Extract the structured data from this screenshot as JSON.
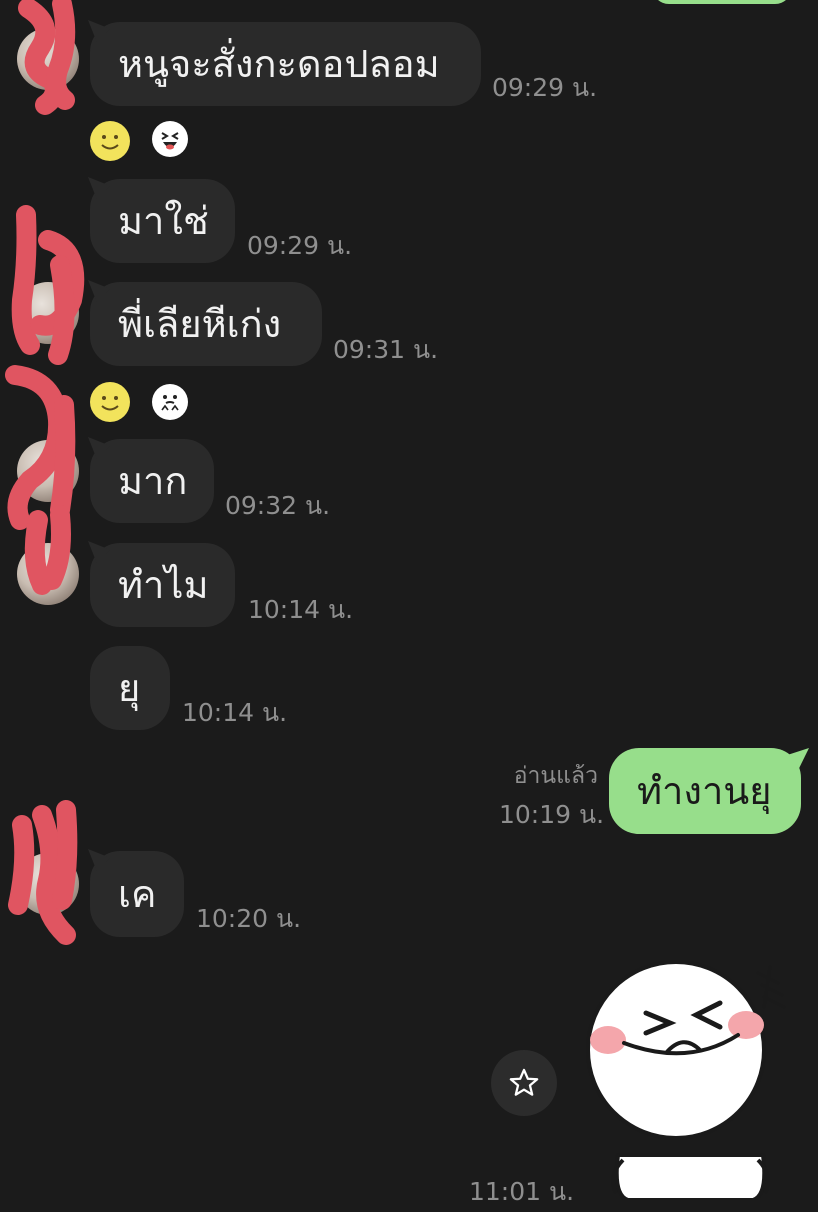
{
  "messages": [
    {
      "text": "หนูจะสั่งกะดอปลอม",
      "time": "09:29 น."
    },
    {
      "text": "มาใช่",
      "time": "09:29 น."
    },
    {
      "text": "พี่เลียหีเก่ง",
      "time": "09:31 น."
    },
    {
      "text": "มาก",
      "time": "09:32 น."
    },
    {
      "text": "ทำไม",
      "time": "10:14 น."
    },
    {
      "text": "ยุ",
      "time": "10:14 น."
    },
    {
      "text": "ทำงานยุ",
      "time": "10:19 น.",
      "status": "อ่านแล้ว"
    },
    {
      "text": "เค",
      "time": "10:20 น."
    },
    {
      "time": "11:01 น."
    }
  ],
  "colors": {
    "background": "#1b1b1b",
    "received_bubble": "#2a2a2a",
    "sent_bubble": "#97de8b",
    "timestamp": "#8f8f8f",
    "redaction": "#e05561"
  },
  "icons": {
    "star_button": "star-icon",
    "reaction_smile": "smile-reaction-icon",
    "reaction_sticker": "laugh-sticker-icon",
    "reaction_sticker_2": "shy-sticker-icon",
    "sticker": "laughing-face-sticker"
  }
}
